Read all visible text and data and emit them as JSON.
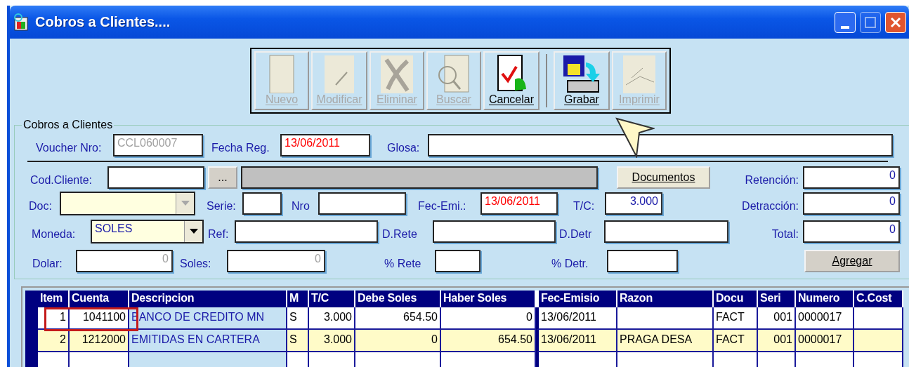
{
  "window": {
    "title": "Cobros a Clientes...."
  },
  "toolbar": {
    "buttons": [
      {
        "kind": "new",
        "label": "Nuevo",
        "disabled": true
      },
      {
        "kind": "edit",
        "label": "Modificar",
        "disabled": true
      },
      {
        "kind": "delete",
        "label": "Eliminar",
        "disabled": true
      },
      {
        "kind": "search",
        "label": "Buscar",
        "disabled": true
      },
      {
        "kind": "cancel",
        "label": "Cancelar",
        "disabled": false
      },
      {
        "kind": "save",
        "label": "Grabar",
        "disabled": false
      },
      {
        "kind": "print",
        "label": "Imprimir",
        "disabled": true
      }
    ]
  },
  "form": {
    "legend": "Cobros a Clientes",
    "top": {
      "items": [
        {
          "kind": "label",
          "text": "Voucher Nro:"
        },
        {
          "kind": "field",
          "value": "CCL060007",
          "disabled": true
        },
        {
          "kind": "label",
          "text": "Fecha Reg."
        },
        {
          "kind": "field",
          "value": "13/06/2011",
          "color": "#ff0000"
        },
        {
          "kind": "label",
          "text": "Glosa:"
        },
        {
          "kind": "field"
        }
      ]
    },
    "rows": [
      {
        "items": [
          {
            "kind": "label",
            "text": "Cod.Cliente:"
          },
          {
            "kind": "field"
          },
          {
            "kind": "button",
            "text": "..."
          },
          {
            "kind": "display"
          },
          {
            "kind": "button",
            "text": "Documentos"
          }
        ]
      },
      {
        "items": [
          {
            "kind": "label",
            "text": "Doc:"
          },
          {
            "kind": "combo",
            "disabled": true
          },
          {
            "kind": "label",
            "text": "Serie:"
          },
          {
            "kind": "field"
          },
          {
            "kind": "label",
            "text": "Nro"
          },
          {
            "kind": "field"
          },
          {
            "kind": "label",
            "text": "Fec-Emi.:"
          },
          {
            "kind": "field",
            "value": "13/06/2011",
            "color": "#ff0000"
          },
          {
            "kind": "label",
            "text": "T/C:"
          },
          {
            "kind": "field",
            "value": "3.000"
          }
        ]
      },
      {
        "items": [
          {
            "kind": "label",
            "text": "Moneda:"
          },
          {
            "kind": "combo",
            "value": "SOLES",
            "disabled": false
          },
          {
            "kind": "label",
            "text": "Ref:"
          },
          {
            "kind": "field"
          },
          {
            "kind": "label",
            "text": "D.Rete"
          },
          {
            "kind": "field"
          },
          {
            "kind": "label",
            "text": "D.Detr"
          },
          {
            "kind": "field"
          }
        ]
      },
      {
        "items": [
          {
            "kind": "label",
            "text": "Dolar:"
          },
          {
            "kind": "field",
            "value": "0",
            "disabled": true
          },
          {
            "kind": "label",
            "text": "Soles:"
          },
          {
            "kind": "field",
            "value": "0",
            "disabled": true
          },
          {
            "kind": "label",
            "text": "% Rete"
          },
          {
            "kind": "field"
          },
          {
            "kind": "label",
            "text": "% Detr."
          },
          {
            "kind": "field"
          }
        ]
      }
    ],
    "totals": [
      {
        "label": "Retención:",
        "value": "0"
      },
      {
        "label": "Detracción:",
        "value": "0"
      },
      {
        "label": "Total:",
        "value": "0"
      }
    ],
    "add_button": "Agregar"
  },
  "table": {
    "columns": [
      "Item",
      "Cuenta",
      "Descripcion",
      "M",
      "T/C",
      "Debe Soles",
      "Haber Soles",
      "Fec-Emisio",
      "Razon",
      "Docu",
      "Seri",
      "Numero",
      "C.Cost"
    ],
    "rows": [
      {
        "selected": false,
        "cells": [
          "1",
          "1041100",
          "BANCO DE CREDITO MN",
          "S",
          "3.000",
          "654.50",
          "0",
          "13/06/2011",
          "",
          "FACT",
          "001",
          "0000017",
          ""
        ]
      },
      {
        "selected": true,
        "cells": [
          "2",
          "1212000",
          "EMITIDAS EN CARTERA",
          "S",
          "3.000",
          "0",
          "654.50",
          "13/06/2011",
          "PRAGA DESA",
          "FACT",
          "001",
          "0000017",
          ""
        ]
      }
    ]
  }
}
